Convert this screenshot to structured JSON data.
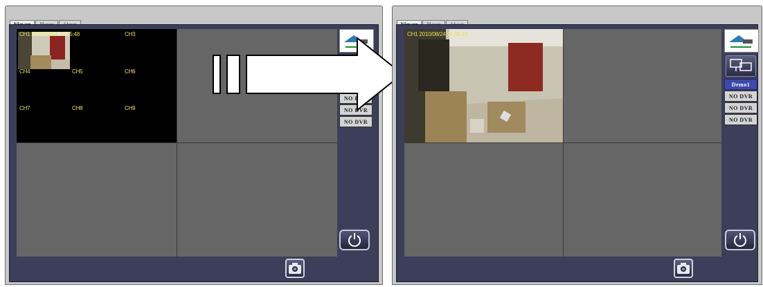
{
  "left_window": {
    "tabs": [
      {
        "label": "Viewer",
        "active": true
      },
      {
        "label": "Player",
        "active": false
      },
      {
        "label": "About",
        "active": false
      }
    ],
    "channels": [
      {
        "label": "CH1 2010/08/24 15:45:48"
      },
      {
        "label": "CH3"
      },
      {
        "label": "CH4"
      },
      {
        "label": "CH5"
      },
      {
        "label": "CH6"
      },
      {
        "label": "CH7"
      },
      {
        "label": "CH8"
      },
      {
        "label": "CH9"
      }
    ],
    "dvr_buttons": [
      "NO DVR",
      "NO DVR",
      "NO DVR"
    ]
  },
  "right_window": {
    "tabs": [
      {
        "label": "Viewer",
        "active": true
      },
      {
        "label": "Player",
        "active": false
      },
      {
        "label": "About",
        "active": false
      }
    ],
    "channel_label": "CH1 2010/08/24 15:46:33",
    "dvr_buttons": [
      {
        "label": "Demo1",
        "selected": true
      },
      {
        "label": "NO DVR",
        "selected": false
      },
      {
        "label": "NO DVR",
        "selected": false
      },
      {
        "label": "NO DVR",
        "selected": false
      }
    ]
  },
  "icons": {
    "power": "power-icon",
    "snapshot": "camera-icon",
    "network": "network-monitors-icon",
    "logo": "house-camera-logo",
    "arrow": "big-right-arrow"
  },
  "colors": {
    "panel_bg": "#3d3e5a",
    "cell_bg": "#666666",
    "channel_text": "#e8e060",
    "selected_dvr": "#3f49a8"
  }
}
